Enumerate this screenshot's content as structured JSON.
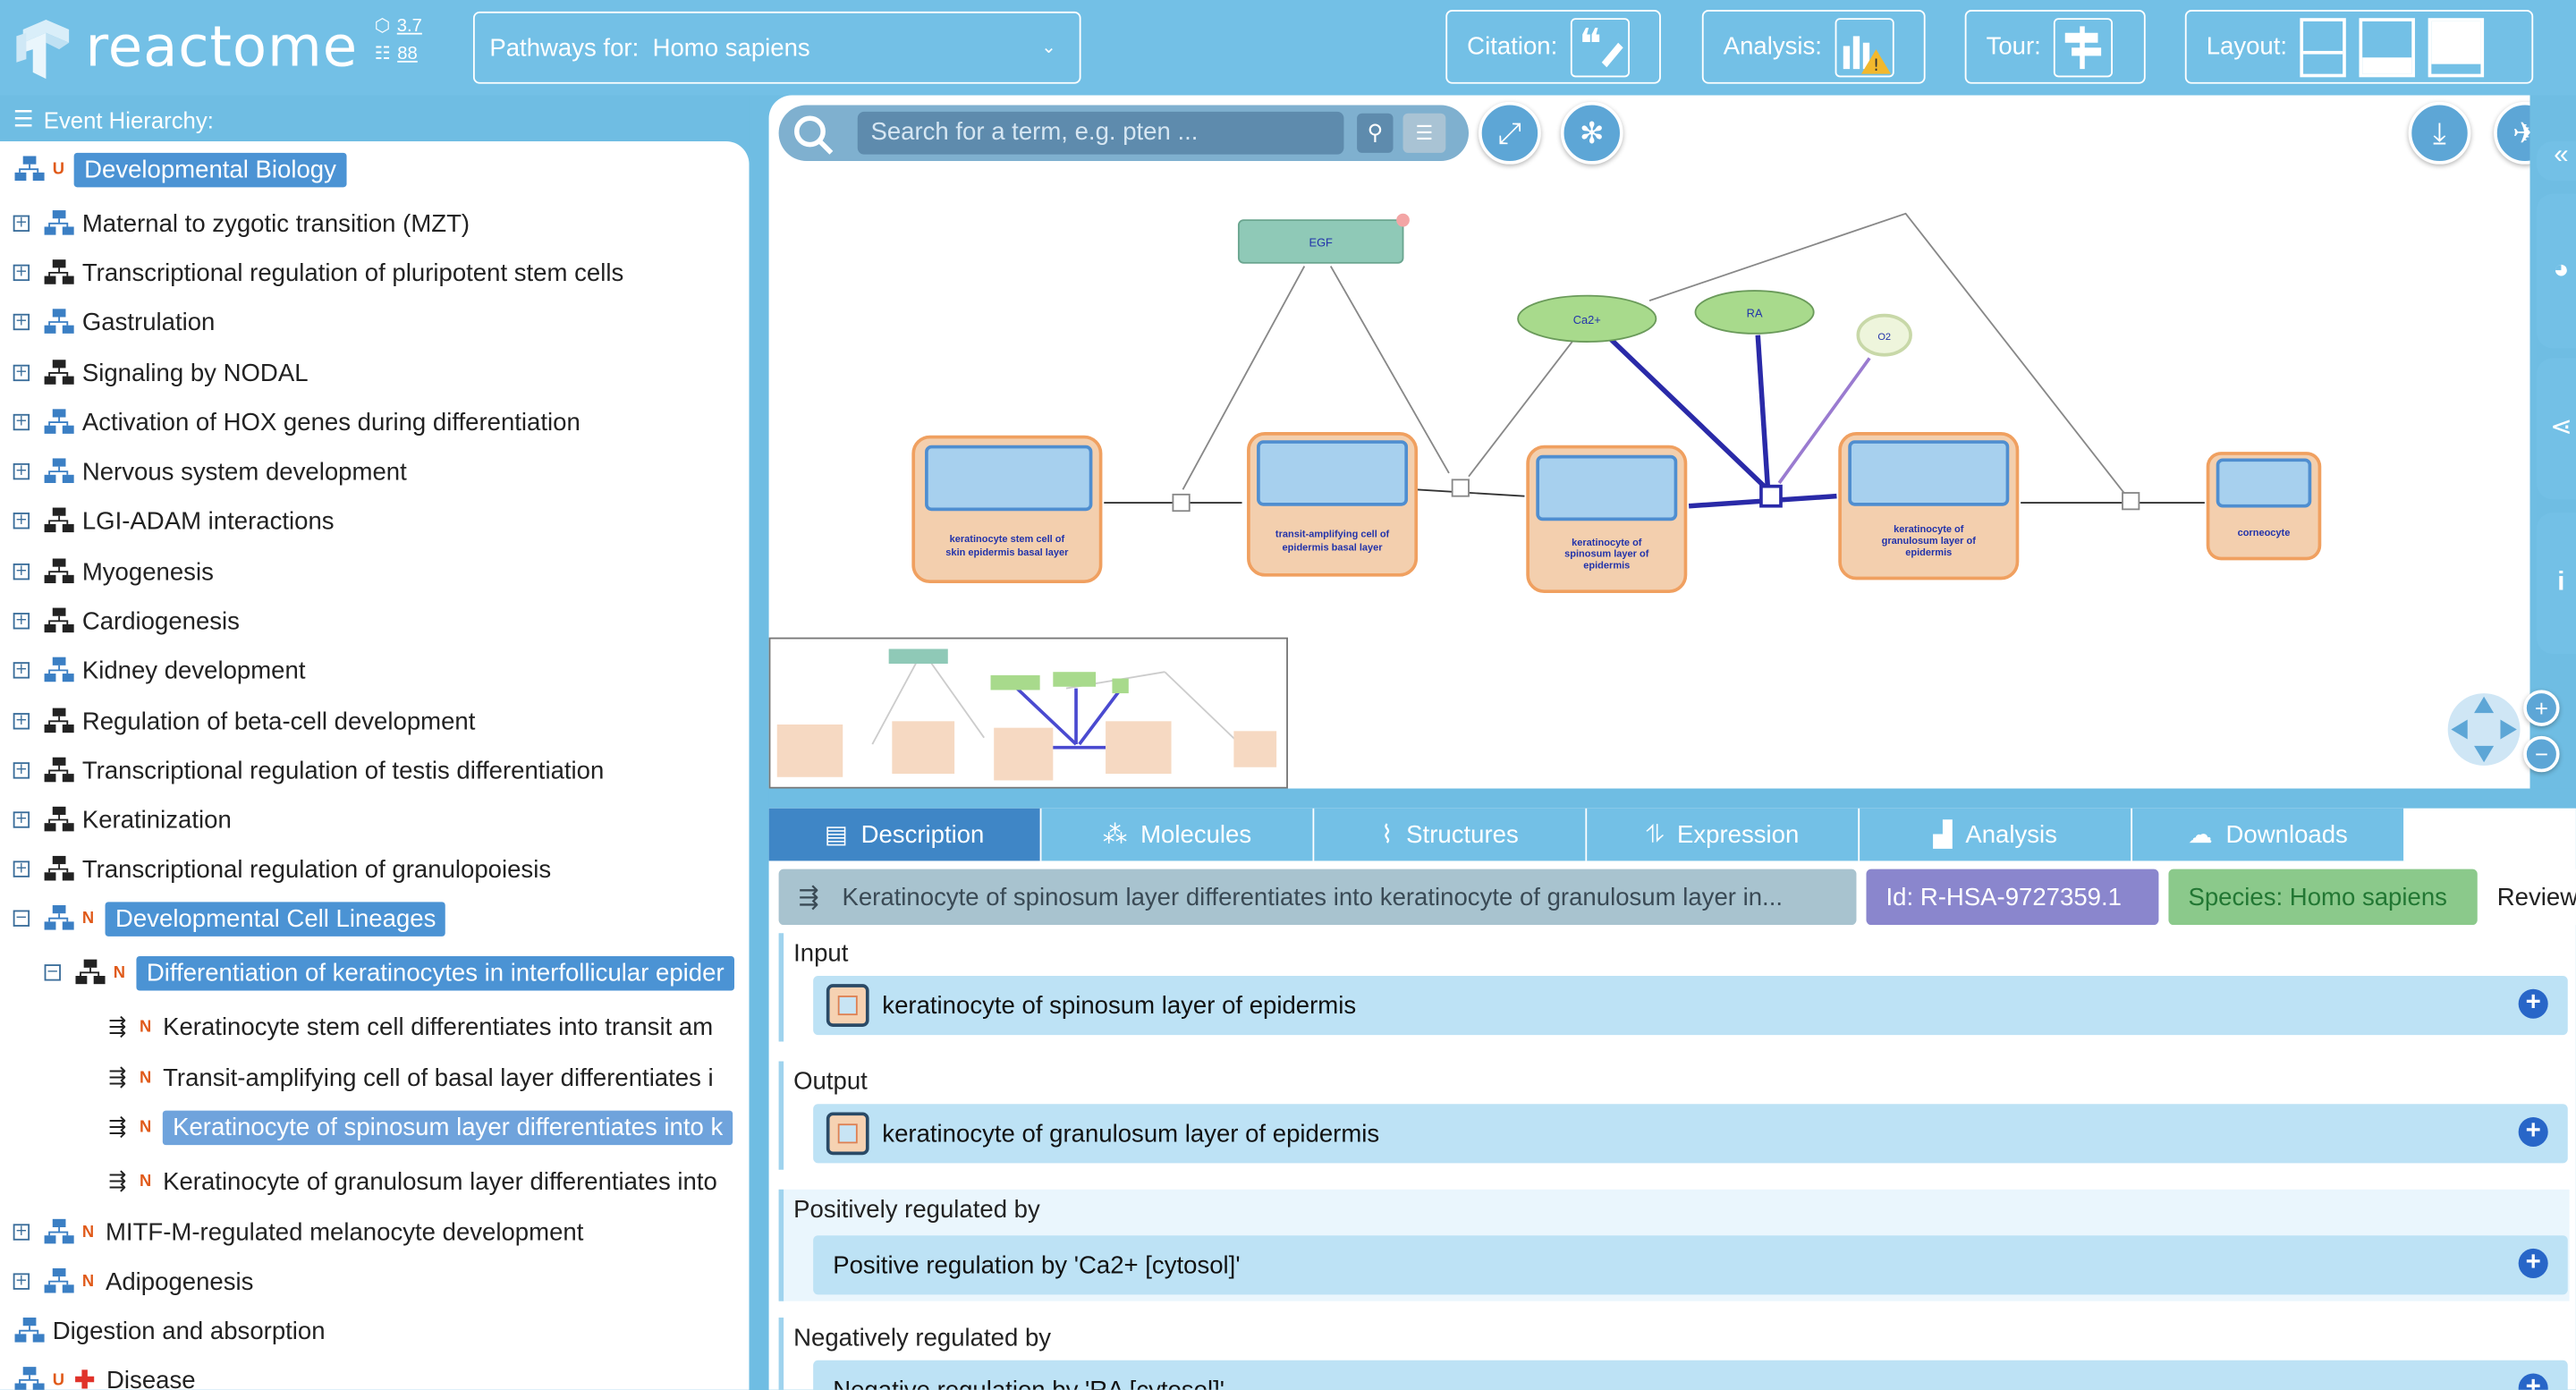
{
  "header": {
    "logo_text": "reactome",
    "version": "3.7",
    "count": "88",
    "species_label": "Pathways for:",
    "species_value": "Homo sapiens",
    "citation_label": "Citation:",
    "analysis_label": "Analysis:",
    "tour_label": "Tour:",
    "layout_label": "Layout:"
  },
  "hierarchy": {
    "title": "Event Hierarchy:",
    "items": [
      {
        "label": "Developmental Biology"
      },
      {
        "label": "Maternal to zygotic transition (MZT)"
      },
      {
        "label": "Transcriptional regulation of pluripotent stem cells"
      },
      {
        "label": "Gastrulation"
      },
      {
        "label": "Signaling by NODAL"
      },
      {
        "label": "Activation of HOX genes during differentiation"
      },
      {
        "label": "Nervous system development"
      },
      {
        "label": "LGI-ADAM interactions"
      },
      {
        "label": "Myogenesis"
      },
      {
        "label": "Cardiogenesis"
      },
      {
        "label": "Kidney development"
      },
      {
        "label": "Regulation of beta-cell development"
      },
      {
        "label": "Transcriptional regulation of testis differentiation"
      },
      {
        "label": "Keratinization"
      },
      {
        "label": "Transcriptional regulation of granulopoiesis"
      },
      {
        "label": "Developmental Cell Lineages"
      },
      {
        "label": "Differentiation of keratinocytes in interfollicular epider"
      },
      {
        "label": "Keratinocyte stem cell differentiates into transit am"
      },
      {
        "label": "Transit-amplifying cell of basal layer differentiates i"
      },
      {
        "label": "Keratinocyte of spinosum layer differentiates into k"
      },
      {
        "label": "Keratinocyte of granulosum layer differentiates into"
      },
      {
        "label": "MITF-M-regulated melanocyte development"
      },
      {
        "label": "Adipogenesis"
      },
      {
        "label": "Digestion and absorption"
      },
      {
        "label": "Disease"
      }
    ]
  },
  "diagram": {
    "search_placeholder": "Search for a term, e.g. pten ...",
    "nodes": {
      "egf": "EGF",
      "ca2": "Ca2+",
      "ra": "RA",
      "o2": "O2",
      "cell1": "keratinocyte stem cell of skin epidermis basal layer",
      "cell2": "transit-amplifying cell of epidermis basal layer",
      "cell3": "keratinocyte of spinosum layer of epidermis",
      "cell4": "keratinocyte of granulosum layer of epidermis",
      "cell5": "corneocyte"
    }
  },
  "details": {
    "tabs": [
      "Description",
      "Molecules",
      "Structures",
      "Expression",
      "Analysis",
      "Downloads"
    ],
    "title": "Keratinocyte of spinosum layer differentiates into keratinocyte of granulosum layer in...",
    "id": "Id: R-HSA-9727359.1",
    "species": "Species: Homo sapiens",
    "review": "Review",
    "input_label": "Input",
    "input_value": "keratinocyte of spinosum layer of epidermis",
    "output_label": "Output",
    "output_value": "keratinocyte of granulosum layer of epidermis",
    "pos_label": "Positively regulated by",
    "pos_value": "Positive regulation by 'Ca2+ [cytosol]'",
    "neg_label": "Negatively regulated by",
    "neg_value": "Negative regulation by 'RA [cytosol]'"
  },
  "colors": {
    "header_bg": "#73c0e6",
    "selection": "#4b93d4",
    "new_badge": "#e05a1a",
    "cell_fill": "#f3cfae",
    "cell_border": "#f0a060",
    "molecule_fill": "#a8da8c",
    "protein_fill": "#8fc9b7"
  }
}
